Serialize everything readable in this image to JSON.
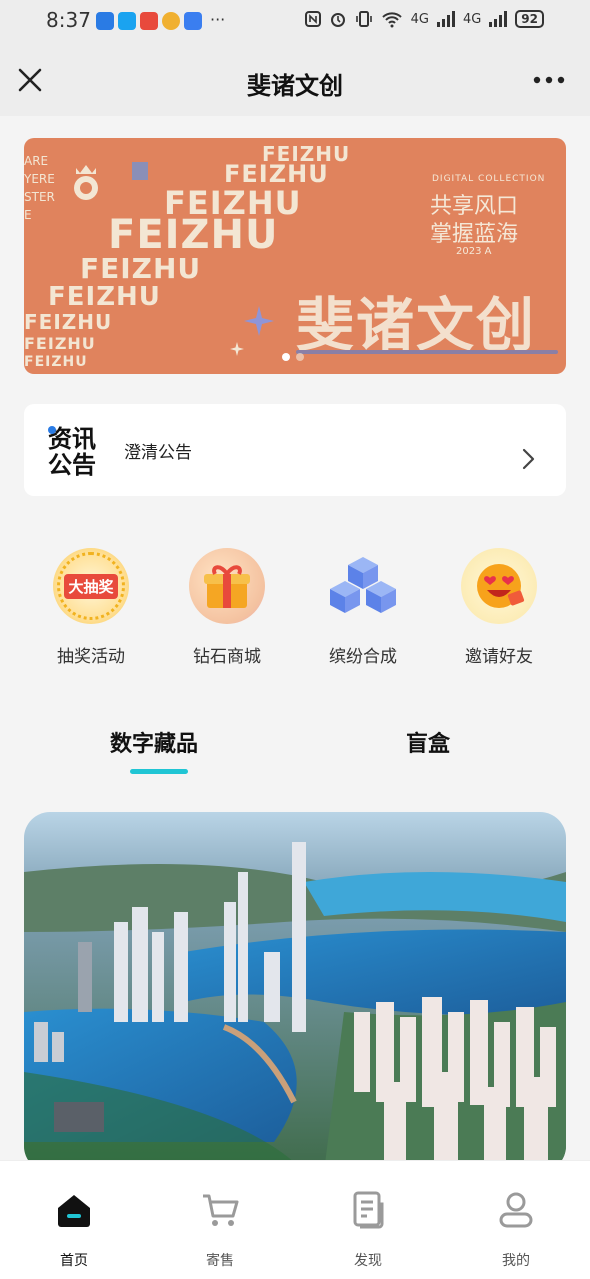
{
  "status_bar": {
    "time": "8:37",
    "extra": "···",
    "net1": "4G",
    "net2": "4G",
    "battery": "92"
  },
  "nav": {
    "title": "斐诸文创",
    "close_icon": "close-icon",
    "more_icon": "more-icon"
  },
  "banner": {
    "slogan_line1": "共享风口",
    "slogan_line2": "掌握蓝海",
    "tag_top": "DIGITAL COLLECTION",
    "tag_bottom": "2023 A",
    "title": "斐诸文创",
    "brand_word": "FEIZHU",
    "left_text_lines": [
      "ARE",
      "YERE",
      "STER",
      "E"
    ],
    "colors": {
      "background": "#e0835d",
      "text": "#f3e6d3"
    }
  },
  "notice": {
    "logo_line1": "资讯",
    "logo_line2": "公告",
    "text": "澄清公告"
  },
  "quick_entries": [
    {
      "label": "抽奖活动",
      "icon": "lottery-icon",
      "badge_text": "大抽奖"
    },
    {
      "label": "钻石商城",
      "icon": "gift-icon"
    },
    {
      "label": "缤纷合成",
      "icon": "cubes-icon"
    },
    {
      "label": "邀请好友",
      "icon": "smiley-icon"
    }
  ],
  "tabs": [
    {
      "label": "数字藏品",
      "active": true
    },
    {
      "label": "盲盒",
      "active": false
    }
  ],
  "accent_color": "#20c5d4",
  "bottom_nav": [
    {
      "label": "首页",
      "icon": "home-icon",
      "active": true
    },
    {
      "label": "寄售",
      "icon": "cart-icon",
      "active": false
    },
    {
      "label": "发现",
      "icon": "document-icon",
      "active": false
    },
    {
      "label": "我的",
      "icon": "user-icon",
      "active": false
    }
  ]
}
